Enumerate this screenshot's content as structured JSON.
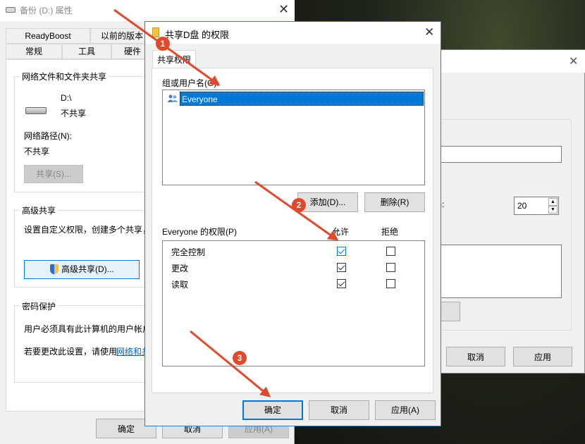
{
  "props_window": {
    "title": "备份 (D:) 属性",
    "tabs_row1": [
      "ReadyBoost",
      "以前的版本"
    ],
    "tabs_row2": [
      "常规",
      "工具",
      "硬件"
    ],
    "share_group": {
      "title": "网络文件和文件夹共享",
      "drive": "D:\\",
      "status": "不共享",
      "path_label": "网络路径(N):",
      "path_value": "不共享",
      "share_button": "共享(S)..."
    },
    "adv_group": {
      "title": "高级共享",
      "desc": "设置自定义权限，创建多个共享，",
      "button": "高级共享(D)..."
    },
    "pwd_group": {
      "title": "密码保护",
      "line1": "用户必须具有此计算机的用户帐户",
      "line2": "若要更改此设置，请使用",
      "link": "网络和共"
    },
    "buttons": {
      "ok": "确定",
      "cancel": "取消",
      "apply": "应用(A)"
    }
  },
  "adv_window": {
    "limit_value": "20",
    "limit_suffix": "):",
    "buttons": {
      "cancel": "取消",
      "apply": "应用"
    }
  },
  "perm_dialog": {
    "title": "共享D盘 的权限",
    "tab": "共享权限",
    "group_label": "组或用户名(G):",
    "users": [
      "Everyone"
    ],
    "add_button": "添加(D)...",
    "remove_button": "删除(R)",
    "perm_label": "Everyone 的权限(P)",
    "col_allow": "允许",
    "col_deny": "拒绝",
    "permissions": [
      {
        "name": "完全控制",
        "allow": true,
        "deny": false
      },
      {
        "name": "更改",
        "allow": true,
        "deny": false
      },
      {
        "name": "读取",
        "allow": true,
        "deny": false
      }
    ],
    "buttons": {
      "ok": "确定",
      "cancel": "取消",
      "apply": "应用(A)"
    }
  },
  "annotations": [
    "1",
    "2",
    "3"
  ],
  "colors": {
    "accent": "#0078d7",
    "annotation": "#e04a2c",
    "selection": "#0078d7"
  }
}
